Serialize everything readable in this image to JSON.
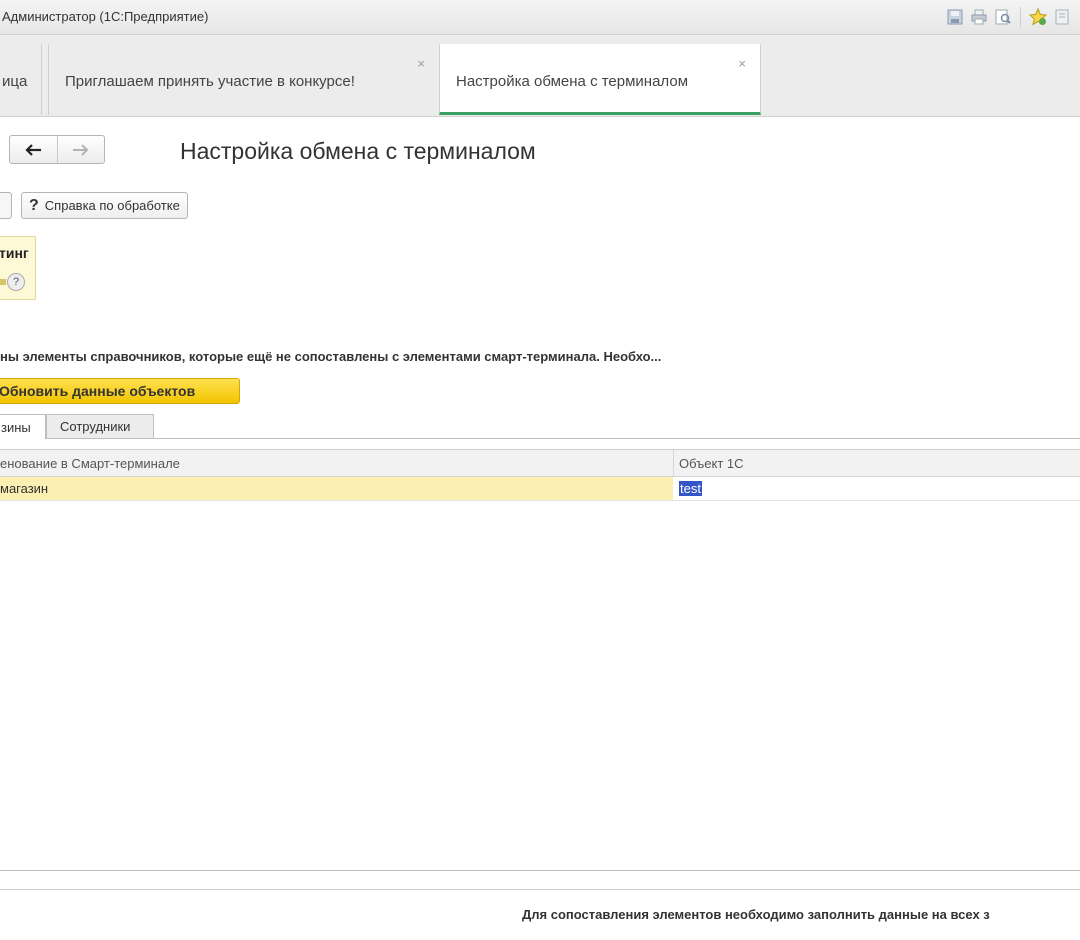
{
  "window": {
    "title": "Администратор  (1С:Предприятие)",
    "icons": [
      "save-icon",
      "print-icon",
      "preview-icon",
      "favorites-icon",
      "bookmark-icon"
    ]
  },
  "tabs": [
    {
      "label": "ица",
      "active": false
    },
    {
      "label": "Приглашаем принять участие в конкурсе!",
      "close": "×",
      "active": false
    },
    {
      "label": "Настройка обмена с терминалом",
      "close": "×",
      "active": true
    }
  ],
  "header": {
    "back": "🡐",
    "forward": "🡒",
    "title": "Настройка обмена с терминалом"
  },
  "toolbar": {
    "help_label": "Справка по обработке",
    "help_icon": "?"
  },
  "info_panel": {
    "caption": "тинг",
    "help": "?"
  },
  "message": "ны элементы справочников, которые ещё не сопоставлены с элементами смарт-терминала. Необхо...",
  "refresh_button": "Обновить данные объектов",
  "inner_tabs": [
    {
      "label": "зины",
      "active": true
    },
    {
      "label": "Сотрудники",
      "active": false
    }
  ],
  "grid": {
    "columns": [
      "енование в Смарт-терминале",
      "Объект 1С"
    ],
    "rows": [
      {
        "name": "магазин",
        "object": "test"
      }
    ]
  },
  "footer": "Для сопоставления элементов необходимо заполнить данные на всех з",
  "colors": {
    "accent": "#3aa262",
    "selection": "#fbefb2",
    "button_yellow": "#f2c400"
  }
}
